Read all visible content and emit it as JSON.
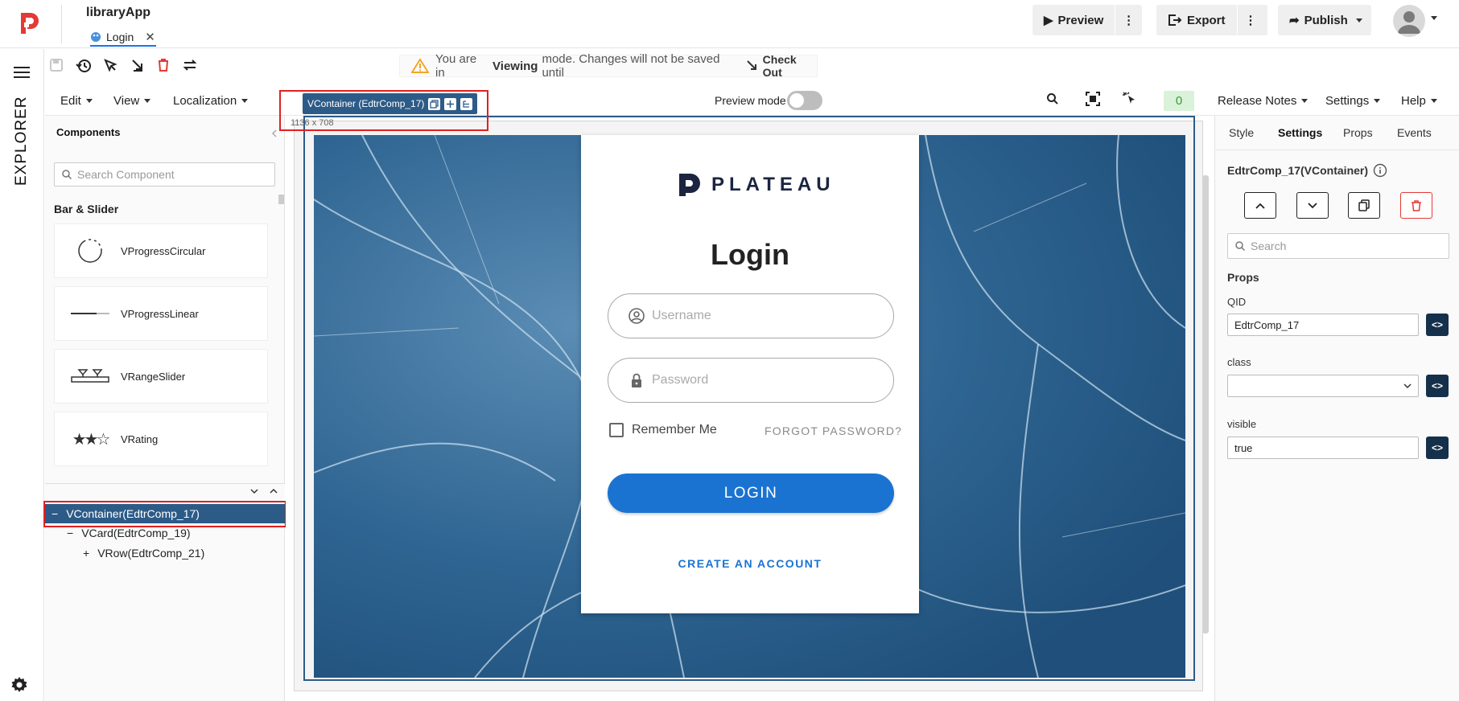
{
  "app": {
    "name": "libraryApp",
    "tab_label": "Login"
  },
  "topbar": {
    "preview": "Preview",
    "export": "Export",
    "publish": "Publish"
  },
  "rail": {
    "explorer": "EXPLORER"
  },
  "banner": {
    "prefix": "You are in",
    "mode": "Viewing",
    "suffix": "mode. Changes will not be saved until",
    "action": "Check Out"
  },
  "menus": {
    "edit": "Edit",
    "view": "View",
    "localization": "Localization",
    "release_notes": "Release Notes",
    "settings": "Settings",
    "help": "Help"
  },
  "selection": {
    "badge": "VContainer (EdtrComp_17)",
    "dims": "1136 x 708"
  },
  "preview_mode": {
    "label": "Preview mode",
    "enabled": false
  },
  "counter": "0",
  "components": {
    "title": "Components",
    "search_placeholder": "Search Component",
    "section": "Bar & Slider",
    "items": [
      "VProgressCircular",
      "VProgressLinear",
      "VRangeSlider",
      "VRating"
    ]
  },
  "tree": {
    "selected": "VContainer(EdtrComp_17)",
    "child1": "VCard(EdtrComp_19)",
    "child2": "VRow(EdtrComp_21)",
    "minus": "−",
    "plus": "+"
  },
  "login_card": {
    "brand": "PLATEAU",
    "title": "Login",
    "username_placeholder": "Username",
    "password_placeholder": "Password",
    "remember": "Remember Me",
    "forgot": "FORGOT PASSWORD?",
    "login_button": "LOGIN",
    "create": "CREATE AN ACCOUNT"
  },
  "right_panel": {
    "tabs": [
      "Style",
      "Settings",
      "Props",
      "Events"
    ],
    "active_tab": "Settings",
    "component_title": "EdtrComp_17(VContainer)",
    "search_placeholder": "Search",
    "section": "Props",
    "qid_label": "QID",
    "qid_value": "EdtrComp_17",
    "class_label": "class",
    "class_value": "",
    "visible_label": "visible",
    "visible_value": "true",
    "code_glyph": "<>"
  },
  "colors": {
    "accent": "#1a73d1",
    "selection": "#2d5b88",
    "brand_red": "#e53935",
    "highlight_box": "#e02020"
  }
}
